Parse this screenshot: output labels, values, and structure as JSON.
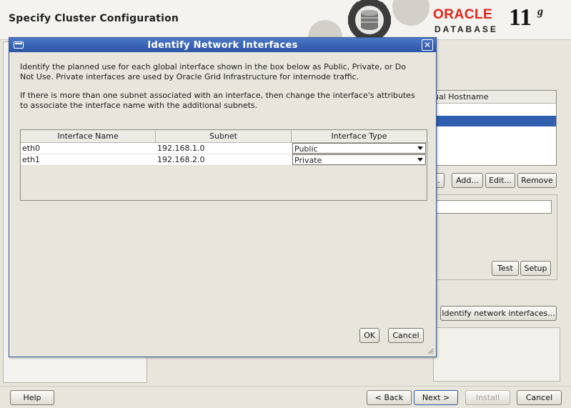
{
  "wizard": {
    "title": "Specify Cluster Configuration",
    "logo": {
      "oracle": "ORACLE",
      "database": "DATABASE",
      "version": "11",
      "version_suffix": "g"
    },
    "table_header_partial": "ual Hostname",
    "buttons": {
      "partial": ".",
      "add": "Add...",
      "edit": "Edit...",
      "remove": "Remove",
      "test": "Test",
      "setup": "Setup",
      "identify_network_interfaces": "Identify network interfaces..."
    },
    "footer": {
      "help": "Help",
      "back": "< Back",
      "next": "Next >",
      "install": "Install",
      "cancel": "Cancel"
    }
  },
  "dialog": {
    "title": "Identify Network Interfaces",
    "description_1": "Identify the planned use for each global interface shown in the box below as Public, Private, or Do Not Use. Private interfaces are used by Oracle Grid Infrastructure for internode traffic.",
    "description_2": "If there is more than one subnet associated with an interface, then change the interface's attributes to associate the interface name with the additional subnets.",
    "table": {
      "columns": [
        "Interface Name",
        "Subnet",
        "Interface Type"
      ],
      "rows": [
        {
          "name": "eth0",
          "subnet": "192.168.1.0",
          "type": "Public"
        },
        {
          "name": "eth1",
          "subnet": "192.168.2.0",
          "type": "Private"
        }
      ]
    },
    "ok": "OK",
    "cancel": "Cancel"
  }
}
